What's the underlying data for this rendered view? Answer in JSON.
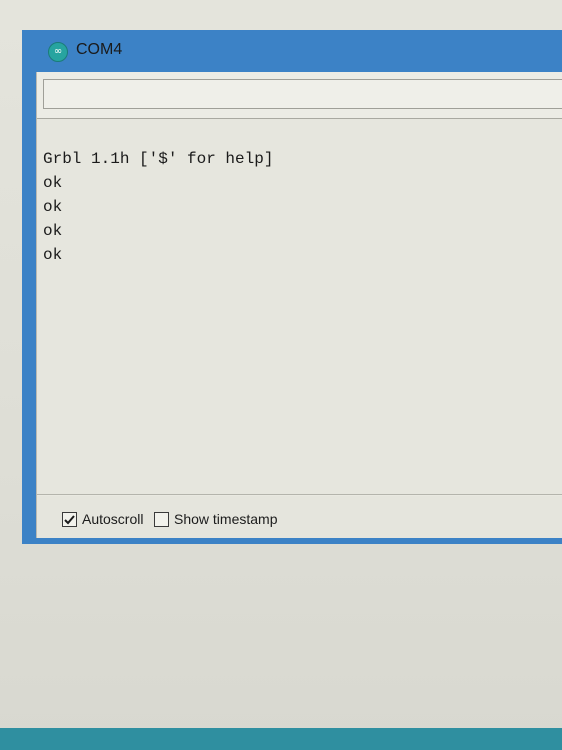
{
  "window": {
    "title": "COM4",
    "icon": "arduino-icon",
    "icon_glyph": "∞",
    "accent_color": "#3c82c6"
  },
  "send": {
    "value": ""
  },
  "output": {
    "lines": [
      "Grbl 1.1h ['$' for help]",
      "ok",
      "ok",
      "ok",
      "ok"
    ]
  },
  "options": {
    "autoscroll": {
      "label": "Autoscroll",
      "checked": true
    },
    "timestamp": {
      "label": "Show timestamp",
      "checked": false
    }
  }
}
